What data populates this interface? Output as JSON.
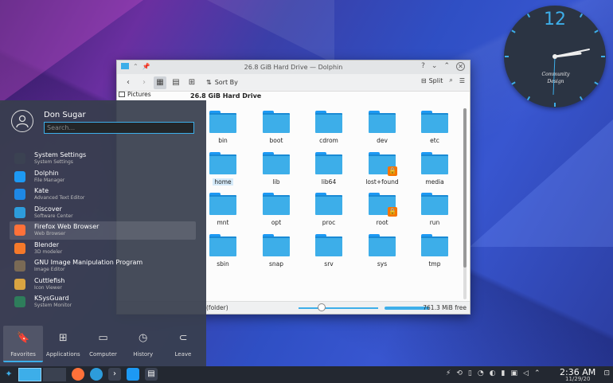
{
  "clock": {
    "number": "12",
    "caption_line1": "Community",
    "caption_line2": "Design"
  },
  "dolphin": {
    "title": "26.8 GiB Hard Drive — Dolphin",
    "sort_label": "Sort By",
    "split_label": "Split",
    "breadcrumb": "26.8 GiB Hard Drive",
    "places_label": "Pictures",
    "items": [
      {
        "name": "bin",
        "lock": false,
        "type": "folder"
      },
      {
        "name": "boot",
        "lock": false,
        "type": "folder"
      },
      {
        "name": "cdrom",
        "lock": false,
        "type": "folder"
      },
      {
        "name": "dev",
        "lock": false,
        "type": "folder"
      },
      {
        "name": "etc",
        "lock": false,
        "type": "folder"
      },
      {
        "name": "home",
        "lock": false,
        "type": "folder",
        "selected": true
      },
      {
        "name": "lib",
        "lock": false,
        "type": "folder"
      },
      {
        "name": "lib64",
        "lock": false,
        "type": "folder"
      },
      {
        "name": "lost+found",
        "lock": true,
        "type": "folder"
      },
      {
        "name": "media",
        "lock": false,
        "type": "folder"
      },
      {
        "name": "mnt",
        "lock": false,
        "type": "folder"
      },
      {
        "name": "opt",
        "lock": false,
        "type": "folder"
      },
      {
        "name": "proc",
        "lock": false,
        "type": "folder"
      },
      {
        "name": "root",
        "lock": true,
        "type": "folder"
      },
      {
        "name": "run",
        "lock": false,
        "type": "folder"
      },
      {
        "name": "sbin",
        "lock": false,
        "type": "folder"
      },
      {
        "name": "snap",
        "lock": false,
        "type": "folder"
      },
      {
        "name": "srv",
        "lock": false,
        "type": "folder"
      },
      {
        "name": "sys",
        "lock": false,
        "type": "folder"
      },
      {
        "name": "tmp",
        "lock": false,
        "type": "folder"
      }
    ],
    "status_info": "(folder)",
    "free_space": "761.3 MiB free"
  },
  "launcher": {
    "user_name": "Don Sugar",
    "search_placeholder": "Search...",
    "apps": [
      {
        "name": "System Settings",
        "desc": "System Settings",
        "color": "#3b4252"
      },
      {
        "name": "Dolphin",
        "desc": "File Manager",
        "color": "#1d99f3"
      },
      {
        "name": "Kate",
        "desc": "Advanced Text Editor",
        "color": "#1e88e5"
      },
      {
        "name": "Discover",
        "desc": "Software Center",
        "color": "#2d9cdb"
      },
      {
        "name": "Firefox Web Browser",
        "desc": "Web Browser",
        "color": "#ff7139"
      },
      {
        "name": "Blender",
        "desc": "3D modeler",
        "color": "#f5792a"
      },
      {
        "name": "GNU Image Manipulation Program",
        "desc": "Image Editor",
        "color": "#7a6a55"
      },
      {
        "name": "Cuttlefish",
        "desc": "Icon Viewer",
        "color": "#d9a441"
      },
      {
        "name": "KSysGuard",
        "desc": "System Monitor",
        "color": "#2e7d5b"
      }
    ],
    "tabs": [
      {
        "label": "Favorites",
        "icon": "bookmark-icon"
      },
      {
        "label": "Applications",
        "icon": "grid-icon"
      },
      {
        "label": "Computer",
        "icon": "monitor-icon"
      },
      {
        "label": "History",
        "icon": "clock-icon"
      },
      {
        "label": "Leave",
        "icon": "leave-icon"
      }
    ]
  },
  "taskbar": {
    "time": "2:36 AM",
    "date": "11/29/20"
  }
}
